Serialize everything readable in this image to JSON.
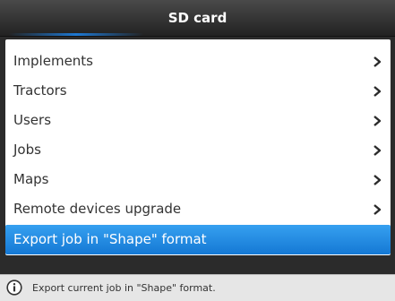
{
  "window": {
    "title": "SD card"
  },
  "menu": {
    "items": [
      {
        "label": "Implements",
        "icon": "chevron-right-icon"
      },
      {
        "label": "Tractors",
        "icon": "chevron-right-icon"
      },
      {
        "label": "Users",
        "icon": "chevron-right-icon"
      },
      {
        "label": "Jobs",
        "icon": "chevron-right-icon"
      },
      {
        "label": "Maps",
        "icon": "chevron-right-icon"
      },
      {
        "label": "Remote devices upgrade",
        "icon": "chevron-right-icon"
      },
      {
        "label": "Export job in \"Shape\" format",
        "selected": true
      }
    ]
  },
  "status": {
    "icon": "info-icon",
    "text": "Export current job in \"Shape\" format."
  },
  "colors": {
    "accent": "#1e88e5",
    "title_bar": "#333333",
    "panel": "#ffffff"
  }
}
